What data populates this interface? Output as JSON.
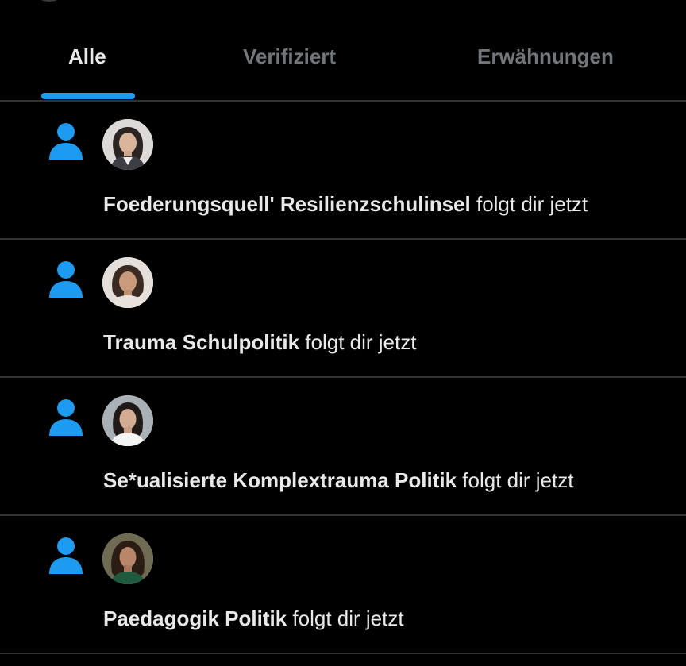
{
  "tabs": [
    {
      "label": "Alle",
      "active": true
    },
    {
      "label": "Verifiziert",
      "active": false
    },
    {
      "label": "Erwähnungen",
      "active": false
    }
  ],
  "notifications": [
    {
      "name": "Foederungsquell' Resilienzschulinsel",
      "action": "folgt dir jetzt",
      "icon": "person-follow-icon"
    },
    {
      "name": "Trauma Schulpolitik",
      "action": "folgt dir jetzt",
      "icon": "person-follow-icon"
    },
    {
      "name": "Se*ualisierte Komplextrauma Politik",
      "action": "folgt dir jetzt",
      "icon": "person-follow-icon"
    },
    {
      "name": "Paedagogik Politik",
      "action": "folgt dir jetzt",
      "icon": "person-follow-icon"
    }
  ],
  "colors": {
    "background": "#000000",
    "accent": "#1d9bf0",
    "text_primary": "#e7e9ea",
    "text_secondary": "#71767b",
    "divider": "#2f3336"
  }
}
